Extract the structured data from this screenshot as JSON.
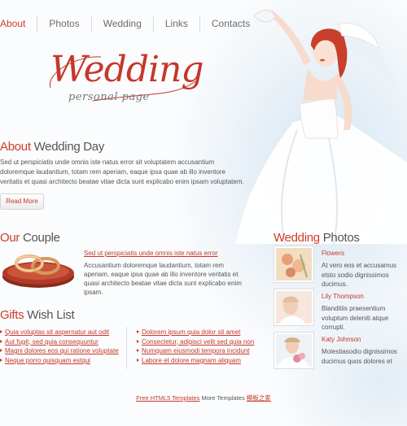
{
  "nav": [
    {
      "label": "About",
      "active": true
    },
    {
      "label": "Photos",
      "active": false
    },
    {
      "label": "Wedding",
      "active": false
    },
    {
      "label": "Links",
      "active": false
    },
    {
      "label": "Contacts",
      "active": false
    }
  ],
  "logo": {
    "title": "Wedding",
    "subtitle": "personal page"
  },
  "about": {
    "heading_accent": "About",
    "heading_rest": " Wedding Day",
    "text": "Sed ut perspiciatis unde omnis iste natus error sit voluptatem accusantium doloremque laudantium, totam rem aperiam, eaque ipsa quae ab illo inventore veritatis et quasi architecto beatae vitae dicta sunt explicabo enim ipsam voluptatem.",
    "button": "Read More"
  },
  "couple": {
    "heading_accent": "Our",
    "heading_rest": " Couple",
    "link": "Sed ut perspiciatis unde omnis iste natus error",
    "text": "Accusantium doloremque laudantium, totam rem aperiam, eaque ipsa quae ab illo inventore veritatis et quasi architecto beatae vitae dicta sunt explicabo enim ipsam."
  },
  "gifts": {
    "heading_accent": "Gifts",
    "heading_rest": " Wish List",
    "left": [
      "Quia voluptas sit aspernatur aut odit",
      "Aut fugit, sed quia consequuntur",
      "Magni dolores eos qui ratione voluptate",
      "Neque porro quisquam estqui"
    ],
    "right": [
      "Dolorem ipsum quia dolor sit amet",
      "Consectetur, adipisci velit sed quia non",
      "Numquam eiusmodi tempora incidunt",
      "Labore et dolore magnam aliquam"
    ]
  },
  "photos": {
    "heading_accent": "Wedding",
    "heading_rest": " Photos",
    "items": [
      {
        "name": "Flowers",
        "desc": "At vero eos et accusamus etsto sodio dignissimos ducimus."
      },
      {
        "name": "Lily Thompson",
        "desc": "Blanditiis praesentium voluptum deleniti atque corrupti."
      },
      {
        "name": "Katy Johnson",
        "desc": "Molestiasodio dignissimos ducimus quos dolores et"
      }
    ]
  },
  "footer": {
    "link1": "Free HTML5 Templates",
    "middle": " More Templates ",
    "link2": "模板之家"
  },
  "colors": {
    "accent": "#d23b28",
    "text": "#555555"
  }
}
